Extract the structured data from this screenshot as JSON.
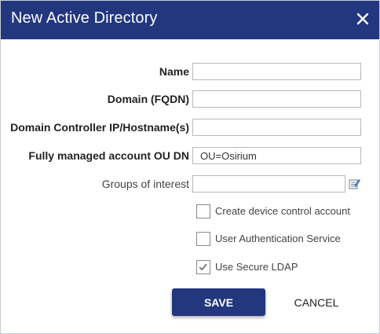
{
  "dialog": {
    "title": "New Active Directory",
    "close_icon": "close-icon",
    "header_color": "#23377f"
  },
  "fields": {
    "name": {
      "label": "Name",
      "value": ""
    },
    "domain": {
      "label": "Domain (FQDN)",
      "value": ""
    },
    "controller": {
      "label": "Domain Controller IP/Hostname(s)",
      "value": ""
    },
    "ou_dn": {
      "label": "Fully managed account OU DN",
      "value": "OU=Osirium"
    },
    "groups": {
      "label": "Groups of interest",
      "value": "",
      "edit_icon": "note-edit-icon"
    }
  },
  "options": {
    "create_device_control": {
      "label": "Create device control account",
      "checked": false
    },
    "user_auth_service": {
      "label": "User Authentication Service",
      "checked": false
    },
    "secure_ldap": {
      "label": "Use Secure LDAP",
      "checked": true
    }
  },
  "buttons": {
    "save": "SAVE",
    "cancel": "CANCEL"
  }
}
